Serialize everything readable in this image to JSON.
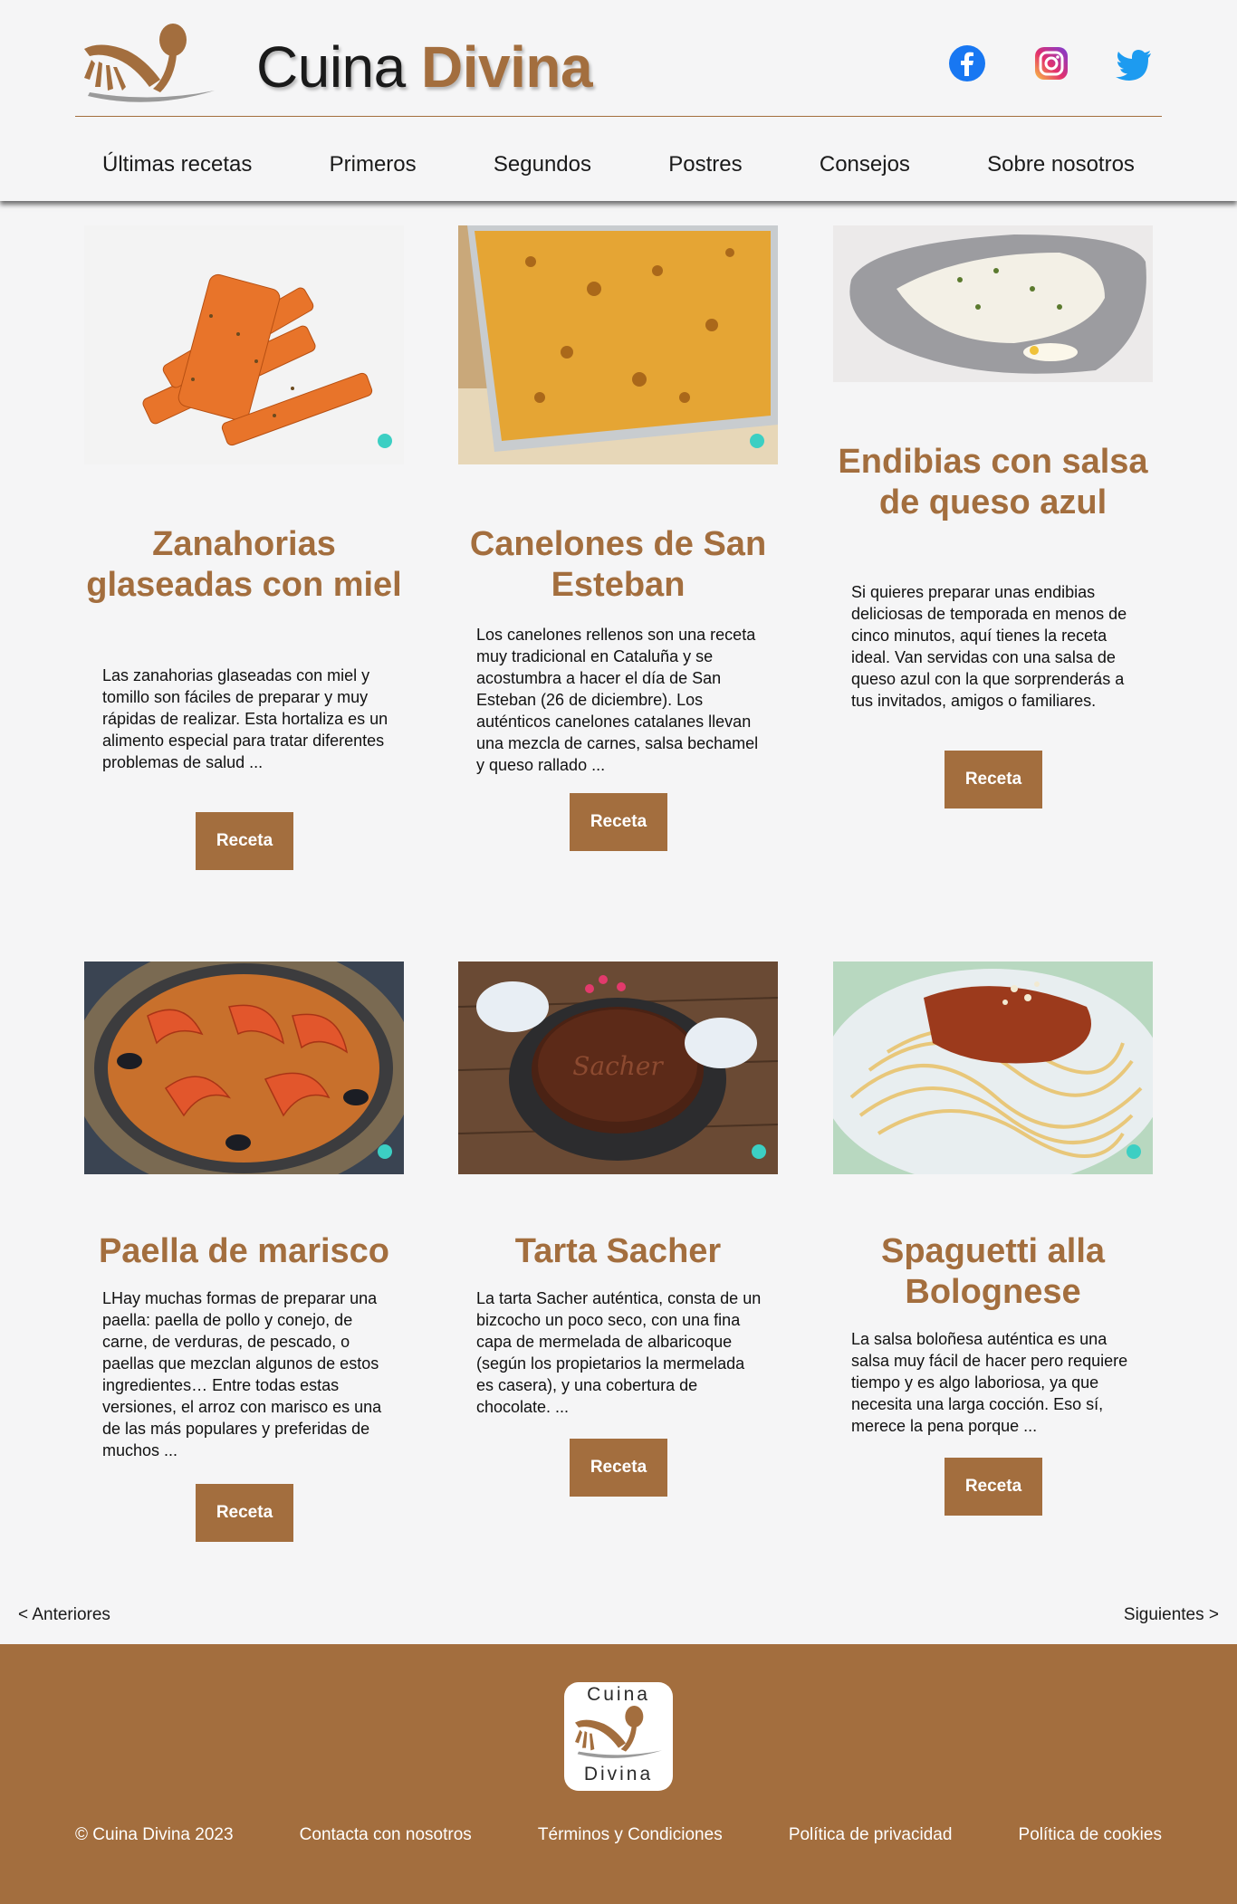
{
  "brand": {
    "word1": "Cuina",
    "word2": "Divina"
  },
  "colors": {
    "accent": "#a36e3e",
    "background": "#f5f5f6",
    "text": "#1e1e1e"
  },
  "social": [
    {
      "icon": "facebook-icon"
    },
    {
      "icon": "instagram-icon"
    },
    {
      "icon": "twitter-icon"
    }
  ],
  "nav": [
    {
      "label": "Últimas recetas"
    },
    {
      "label": "Primeros"
    },
    {
      "label": "Segundos"
    },
    {
      "label": "Postres"
    },
    {
      "label": "Consejos"
    },
    {
      "label": "Sobre nosotros"
    }
  ],
  "recipes": [
    {
      "title": "Zanahorias glaseadas con miel",
      "description": "Las zanahorias glaseadas con miel y tomillo son fáciles de preparar y muy rápidas de realizar. Esta hortaliza es un alimento especial para tratar diferentes problemas de salud ...",
      "button": "Receta"
    },
    {
      "title": "Canelones de San Esteban",
      "description": "Los canelones rellenos son una receta muy tradicional en Cataluña y se acostumbra a hacer el día de San Esteban (26 de diciembre). Los auténticos canelones catalanes llevan una mezcla de carnes, salsa bechamel y queso rallado ...",
      "button": "Receta"
    },
    {
      "title": "Endibias con salsa de queso azul",
      "description": "Si quieres preparar unas endibias deliciosas de temporada en menos de cinco minutos, aquí tienes la receta ideal. Van servidas con una salsa de queso azul con la que sorprenderás a tus invitados, amigos o familiares.",
      "button": "Receta"
    },
    {
      "title": "Paella de marisco",
      "description": "LHay muchas formas de preparar una paella: paella de pollo y conejo, de carne, de verduras, de pescado, o paellas que mezclan algunos de estos ingredientes… Entre todas estas versiones, el arroz con marisco es una de las más populares y preferidas de muchos ...",
      "button": "Receta"
    },
    {
      "title": "Tarta Sacher",
      "description": "La tarta Sacher auténtica, consta de un bizcocho un poco seco, con una fina capa de mermelada de albaricoque (según los propietarios la mermelada es casera), y una cobertura de chocolate. ...",
      "button": "Receta"
    },
    {
      "title": "Spaguetti alla Bolognese",
      "description": "La salsa boloñesa auténtica es una salsa muy fácil de hacer pero requiere tiempo y es algo laboriosa, ya que necesita una larga cocción. Eso sí, merece la pena porque ...",
      "button": "Receta"
    }
  ],
  "pagination": {
    "prev": "< Anteriores",
    "next": "Siguientes >"
  },
  "footer": {
    "logo_top": "Cuina",
    "logo_bottom": "Divina",
    "links": [
      {
        "label": "© Cuina Divina 2023"
      },
      {
        "label": "Contacta con nosotros"
      },
      {
        "label": "Términos y Condiciones"
      },
      {
        "label": "Política de privacidad"
      },
      {
        "label": "Política de cookies"
      }
    ]
  }
}
